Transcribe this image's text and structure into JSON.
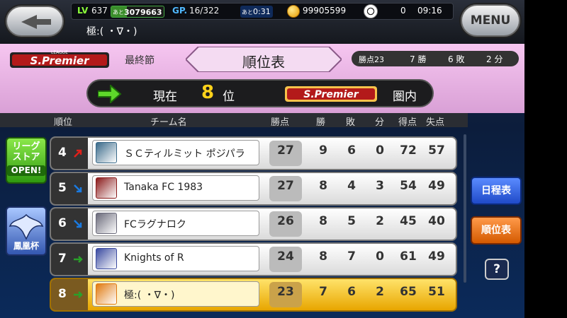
{
  "status_bar": {
    "level_label": "LV",
    "level": "637",
    "exp_prefix": "あと",
    "exp_remaining": "3079663",
    "exp_fill_fraction": 0.3,
    "gp_label": "GP.",
    "gp": "16/322",
    "timer_prefix": "あと",
    "timer": "0:31",
    "coins": "99905599",
    "balls": "0",
    "clock": "09:16",
    "player_name": "極:(  ・∇・)",
    "menu_label": "MENU"
  },
  "header": {
    "league_logo_text": "S.Premier",
    "league_logo_small": "LEAGUE",
    "round_label": "最終節",
    "title": "順位表",
    "points_label": "勝点23",
    "wins": "7 勝",
    "losses": "6 敗",
    "draws": "2 分"
  },
  "rank_bar": {
    "current_label": "現在",
    "rank": "8",
    "rank_unit": "位",
    "zone_logo_text": "S.Premier",
    "zone_label": "圏内"
  },
  "columns": [
    "順位",
    "チーム名",
    "勝点",
    "勝",
    "敗",
    "分",
    "得点",
    "失点"
  ],
  "rows": [
    {
      "rank": "4",
      "trend": "up",
      "team": "ＳＣティルミット ポジパラ",
      "points": "27",
      "w": "9",
      "l": "6",
      "d": "0",
      "gf": "72",
      "ga": "57",
      "highlight": false,
      "emblem_color": "#3a6a8a"
    },
    {
      "rank": "5",
      "trend": "down",
      "team": "Tanaka FC 1983",
      "points": "27",
      "w": "8",
      "l": "4",
      "d": "3",
      "gf": "54",
      "ga": "49",
      "highlight": false,
      "emblem_color": "#8a1a1a"
    },
    {
      "rank": "6",
      "trend": "down",
      "team": "FCラグナロク",
      "points": "26",
      "w": "8",
      "l": "5",
      "d": "2",
      "gf": "45",
      "ga": "40",
      "highlight": false,
      "emblem_color": "#6a6a7a"
    },
    {
      "rank": "7",
      "trend": "same",
      "team": "Knights of R",
      "points": "24",
      "w": "8",
      "l": "7",
      "d": "0",
      "gf": "61",
      "ga": "49",
      "highlight": false,
      "emblem_color": "#3a4aa0"
    },
    {
      "rank": "8",
      "trend": "same",
      "team": "極:(  ・∇・)",
      "points": "23",
      "w": "7",
      "l": "6",
      "d": "2",
      "gf": "65",
      "ga": "51",
      "highlight": true,
      "emblem_color": "#e07a10"
    }
  ],
  "side_buttons": {
    "league_store_line1": "リーグ",
    "league_store_line2": "ストア",
    "league_store_open": "OPEN!",
    "cup_label": "鳳凰杯",
    "schedule": "日程表",
    "standings": "順位表",
    "help": "?"
  },
  "colors": {
    "header_pink": "#f6c6f0",
    "rank_yellow": "#ffd21a",
    "highlight_gold": "#e8a600",
    "trend_up": "#e0201a",
    "trend_down": "#1a7ae0",
    "trend_same": "#2aa02a"
  }
}
